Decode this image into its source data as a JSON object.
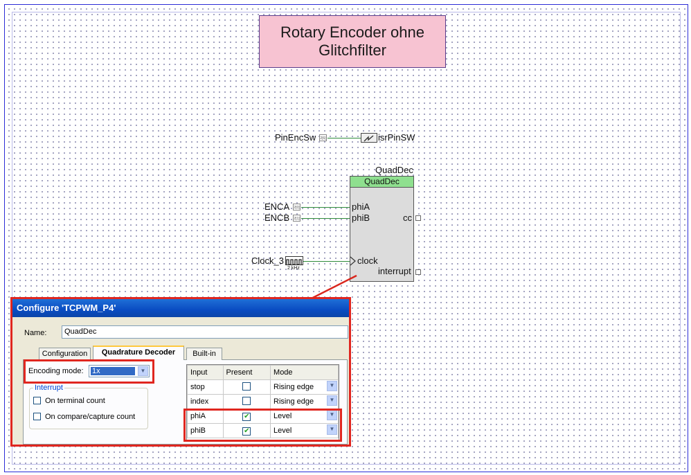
{
  "schematic": {
    "title_lines": [
      "Rotary Encoder ohne",
      "Glitchfilter"
    ],
    "pin_enc_sw": "PinEncSw",
    "isr_name": "isrPinSW",
    "comp_instance_name": "QuadDec",
    "comp_type": "QuadDec",
    "enca": "ENCA",
    "encb": "ENCB",
    "phiA": "phiA",
    "phiB": "phiB",
    "cc": "cc",
    "clock_name": "Clock_3",
    "clock_freq": "2 kHz",
    "clock_port": "clock",
    "interrupt": "interrupt",
    "accent_wire": "#2e8b3a",
    "highlight_red": "#e0261f"
  },
  "dialog": {
    "title": "Configure 'TCPWM_P4'",
    "name_label": "Name:",
    "name_value": "QuadDec",
    "tabs": [
      "Configuration",
      "Quadrature Decoder",
      "Built-in"
    ],
    "active_tab": "Quadrature Decoder",
    "encoding_label": "Encoding mode:",
    "encoding_value": "1x",
    "interrupt_group": "Interrupt",
    "checkbox_terminal": "On terminal count",
    "checkbox_compare": "On compare/capture count",
    "grid_headers": [
      "Input",
      "Present",
      "Mode"
    ],
    "grid_rows": [
      {
        "input": "stop",
        "present": false,
        "mode": "Rising edge"
      },
      {
        "input": "index",
        "present": false,
        "mode": "Rising edge"
      },
      {
        "input": "phiA",
        "present": true,
        "mode": "Level"
      },
      {
        "input": "phiB",
        "present": true,
        "mode": "Level"
      }
    ]
  }
}
